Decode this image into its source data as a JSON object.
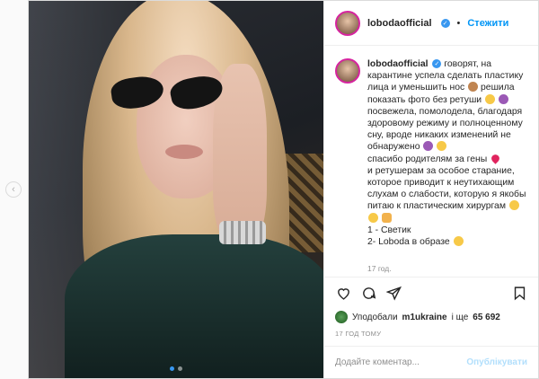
{
  "nav": {
    "prev_icon": "chevron-left-icon"
  },
  "header": {
    "username": "lobodaofficial",
    "separator": "•",
    "follow_label": "Стежити"
  },
  "caption": {
    "username": "lobodaofficial",
    "lines": [
      "говорят, на карантине успела сделать пластику лица и уменьшить нос",
      "решила показать фото без ретуши",
      "посвежела, помолодела, благодаря здоровому режиму и полноценному сну, вроде никаких изменений не обнаружено",
      "спасибо родителям за гены",
      "и ретушерам за особое старание, которое приводит к неутихающим слухам о слабости, которую я якобы питаю к пластическим хирургам",
      "1 - Светик",
      "2- Loboda в образе"
    ],
    "time": "17 год."
  },
  "likes": {
    "prefix": "Уподобали",
    "user": "m1ukraine",
    "middle": "і ще",
    "count": "65 692"
  },
  "post_time": "17 ГОД ТОМУ",
  "comment": {
    "placeholder": "Додайте коментар...",
    "post_label": "Опублікувати"
  },
  "colors": {
    "accent": "#0095f6",
    "verified": "#3897f0",
    "post_disabled": "#b2dffc",
    "muted": "#8e8e8e"
  }
}
